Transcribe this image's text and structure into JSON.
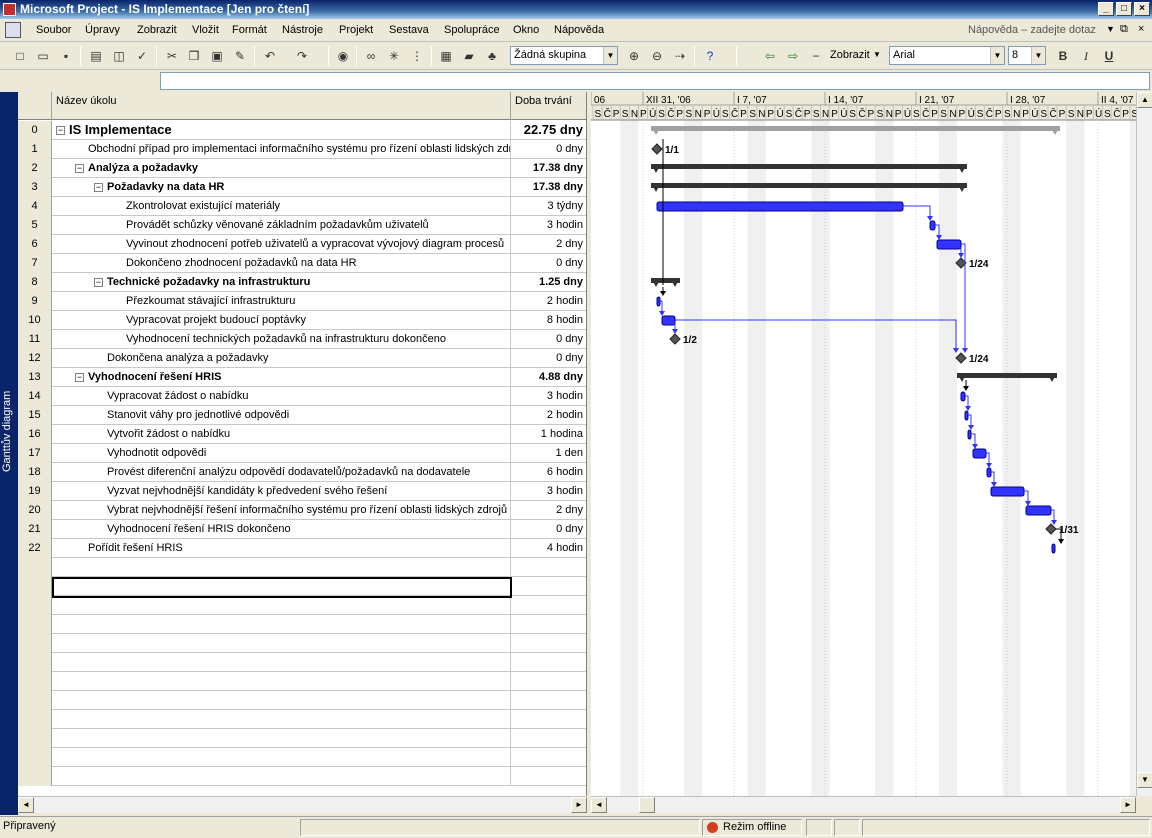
{
  "window": {
    "title": "Microsoft Project - IS Implementace [Jen pro čtení]"
  },
  "menu": {
    "items": [
      "Soubor",
      "Úpravy",
      "Zobrazit",
      "Vložit",
      "Formát",
      "Nástroje",
      "Projekt",
      "Sestava",
      "Spolupráce",
      "Okno",
      "Nápověda"
    ],
    "help_placeholder": "Nápověda – zadejte dotaz"
  },
  "toolbar": {
    "group": "Žádná skupina",
    "show": "Zobrazit",
    "font": "Arial",
    "size": "8",
    "bold": "B",
    "italic": "I",
    "underline": "U"
  },
  "sidebar": {
    "label": "Ganttův diagram"
  },
  "table": {
    "headers": {
      "name": "Název úkolu",
      "duration": "Doba trvání"
    },
    "rows": [
      {
        "id": "0",
        "name": "IS Implementace",
        "duration": "22.75 dny",
        "level": 0,
        "summary": true
      },
      {
        "id": "1",
        "name": "Obchodní případ pro implementaci informačního systému pro řízení oblasti lidských zdro",
        "duration": "0 dny",
        "level": 1,
        "summary": false
      },
      {
        "id": "2",
        "name": "Analýza a požadavky",
        "duration": "17.38 dny",
        "level": 1,
        "summary": true
      },
      {
        "id": "3",
        "name": "Požadavky na data HR",
        "duration": "17.38 dny",
        "level": 2,
        "summary": true
      },
      {
        "id": "4",
        "name": "Zkontrolovat existující materiály",
        "duration": "3 týdny",
        "level": 3,
        "summary": false
      },
      {
        "id": "5",
        "name": "Provádět schůzky věnované základním požadavkům uživatelů",
        "duration": "3 hodin",
        "level": 3,
        "summary": false
      },
      {
        "id": "6",
        "name": "Vyvinout zhodnocení potřeb uživatelů a vypracovat vývojový diagram procesů",
        "duration": "2 dny",
        "level": 3,
        "summary": false
      },
      {
        "id": "7",
        "name": "Dokončeno zhodnocení požadavků na data HR",
        "duration": "0 dny",
        "level": 3,
        "summary": false
      },
      {
        "id": "8",
        "name": "Technické požadavky na infrastrukturu",
        "duration": "1.25 dny",
        "level": 2,
        "summary": true
      },
      {
        "id": "9",
        "name": "Přezkoumat stávající infrastrukturu",
        "duration": "2 hodin",
        "level": 3,
        "summary": false
      },
      {
        "id": "10",
        "name": "Vypracovat projekt budoucí poptávky",
        "duration": "8 hodin",
        "level": 3,
        "summary": false
      },
      {
        "id": "11",
        "name": "Vyhodnocení technických požadavků na infrastrukturu dokončeno",
        "duration": "0 dny",
        "level": 3,
        "summary": false
      },
      {
        "id": "12",
        "name": "Dokončena analýza a požadavky",
        "duration": "0 dny",
        "level": 2,
        "summary": false
      },
      {
        "id": "13",
        "name": "Vyhodnocení řešení HRIS",
        "duration": "4.88 dny",
        "level": 1,
        "summary": true
      },
      {
        "id": "14",
        "name": "Vypracovat žádost o nabídku",
        "duration": "3 hodin",
        "level": 2,
        "summary": false
      },
      {
        "id": "15",
        "name": "Stanovit váhy pro jednotlivé odpovědi",
        "duration": "2 hodin",
        "level": 2,
        "summary": false
      },
      {
        "id": "16",
        "name": "Vytvořit žádost o nabídku",
        "duration": "1 hodina",
        "level": 2,
        "summary": false
      },
      {
        "id": "17",
        "name": "Vyhodnotit odpovědi",
        "duration": "1 den",
        "level": 2,
        "summary": false
      },
      {
        "id": "18",
        "name": "Provést diferenční analýzu odpovědí dodavatelů/požadavků na dodavatele",
        "duration": "6 hodin",
        "level": 2,
        "summary": false
      },
      {
        "id": "19",
        "name": "Vyzvat nejvhodnější kandidáty k předvedení svého řešení",
        "duration": "3 hodin",
        "level": 2,
        "summary": false
      },
      {
        "id": "20",
        "name": "Vybrat nejvhodnější řešení informačního systému pro řízení oblasti lidských zdrojů",
        "duration": "2 dny",
        "level": 2,
        "summary": false
      },
      {
        "id": "21",
        "name": "Vyhodnocení řešení HRIS dokončeno",
        "duration": "0 dny",
        "level": 2,
        "summary": false
      },
      {
        "id": "22",
        "name": "Pořídit řešení HRIS",
        "duration": "4 hodin",
        "level": 1,
        "summary": false
      }
    ]
  },
  "gantt": {
    "weeks": [
      "06",
      "XII 31, '06",
      "I 7, '07",
      "I 14, '07",
      "I 21, '07",
      "I 28, '07",
      "II 4, '07"
    ],
    "days": [
      "S",
      "Č",
      "P",
      "S",
      "N",
      "P",
      "Ú",
      "S",
      "Č",
      "P",
      "S",
      "N",
      "P",
      "Ú",
      "S",
      "Č",
      "P",
      "S",
      "N",
      "P",
      "Ú",
      "S",
      "Č",
      "P",
      "S",
      "N",
      "P",
      "Ú",
      "S",
      "Č",
      "P",
      "S",
      "N",
      "P",
      "Ú",
      "S",
      "Č",
      "P",
      "S",
      "N",
      "P",
      "Ú",
      "S",
      "Č",
      "P",
      "S",
      "N",
      "P",
      "Ú",
      "S",
      "Č",
      "P",
      "S",
      "N",
      "P",
      "Ú",
      "S",
      "Č",
      "P",
      "S",
      "N"
    ],
    "labels": {
      "m1": "1/1",
      "m7": "1/24",
      "m11": "1/2",
      "m12": "1/24",
      "m21": "1/31"
    }
  },
  "status": {
    "ready": "Připravený",
    "offline": "Režim offline"
  },
  "colors": {
    "task": "#3333ff",
    "summary": "#333333",
    "titlebar": "#0a246a"
  }
}
